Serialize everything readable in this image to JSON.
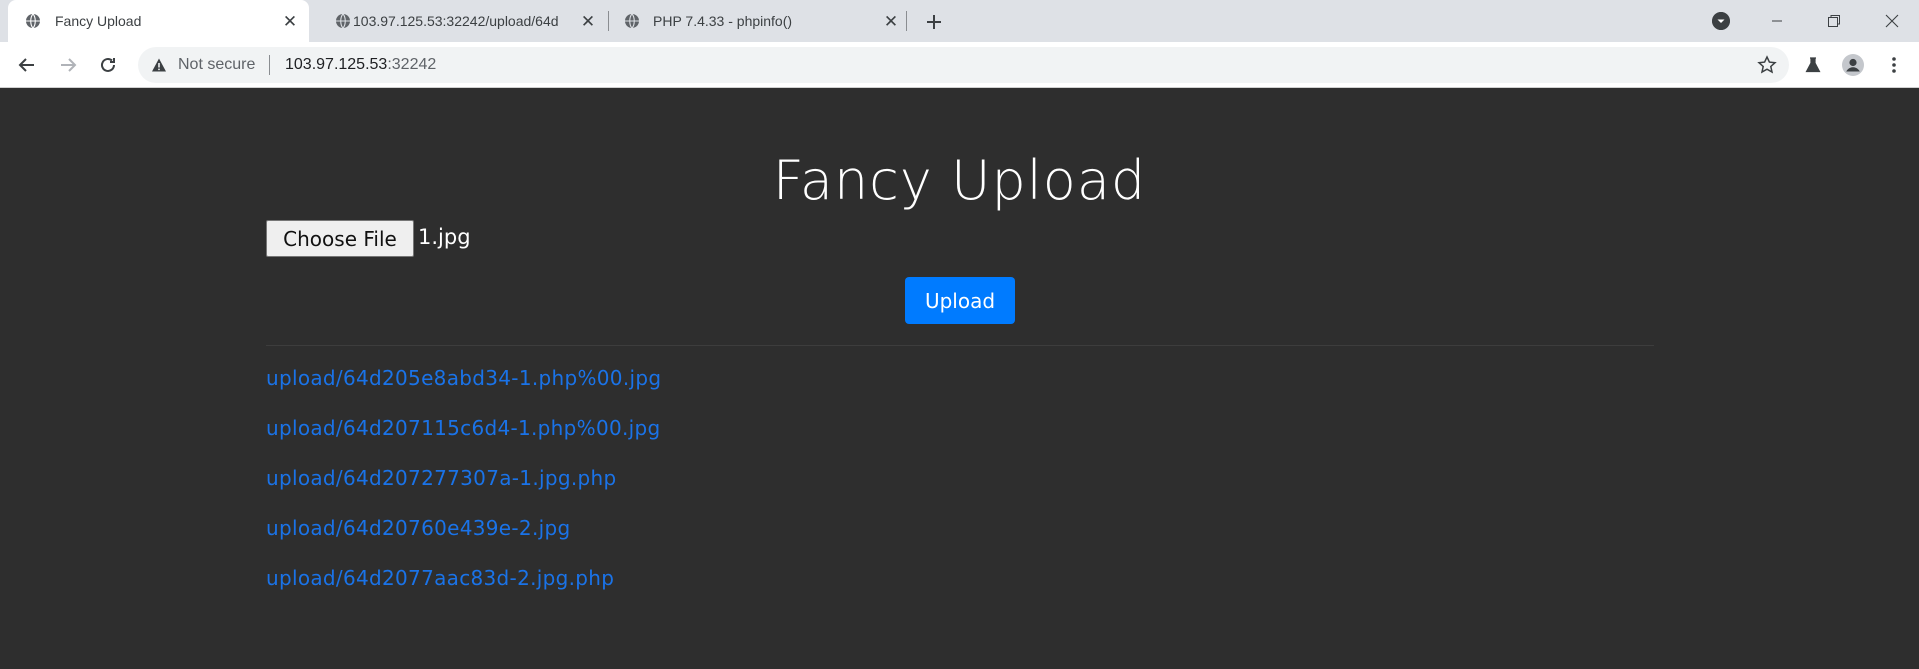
{
  "browser": {
    "tabs": [
      {
        "label": "Fancy Upload",
        "active": true,
        "icon": "globe-icon"
      },
      {
        "label": "103.97.125.53:32242/upload/64d",
        "active": false,
        "icon": "globe-icon"
      },
      {
        "label": "PHP 7.4.33 - phpinfo()",
        "active": false,
        "icon": "globe-icon"
      }
    ],
    "omnibox": {
      "security_label": "Not secure",
      "url_host": "103.97.125.53",
      "url_port": ":32242"
    }
  },
  "page": {
    "title": "Fancy Upload",
    "file_input": {
      "button_label": "Choose File",
      "selected_file": "1.jpg"
    },
    "upload_button_label": "Upload",
    "uploads": [
      "upload/64d205e8abd34-1.php%00.jpg",
      "upload/64d207115c6d4-1.php%00.jpg",
      "upload/64d207277307a-1.jpg.php",
      "upload/64d20760e439e-2.jpg",
      "upload/64d2077aac83d-2.jpg.php"
    ]
  },
  "colors": {
    "page_background": "#2e2e2e",
    "accent_button": "#007bff",
    "link": "#1a73e8"
  }
}
